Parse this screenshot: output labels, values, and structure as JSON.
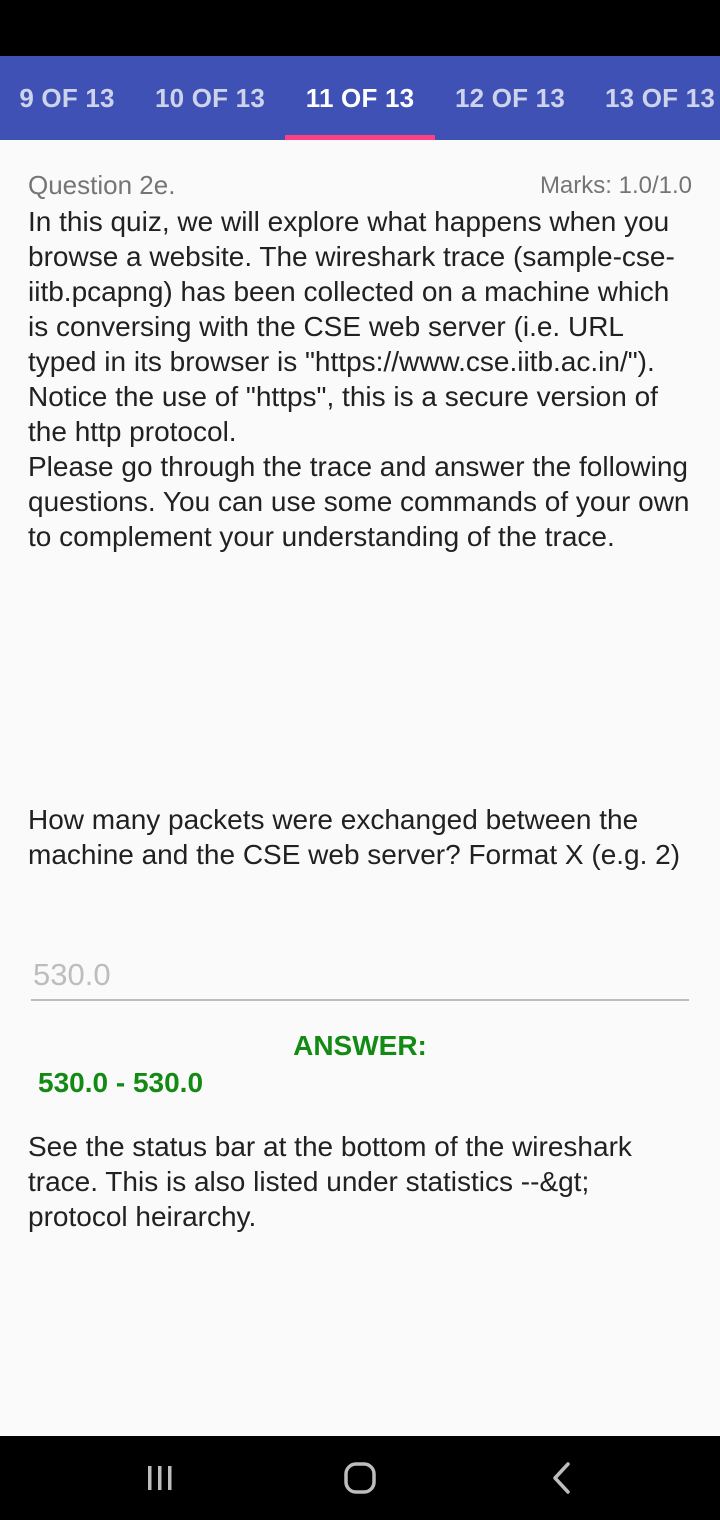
{
  "tabs": [
    {
      "label": "9 OF 13",
      "active": false
    },
    {
      "label": "10 OF 13",
      "active": false
    },
    {
      "label": "11 OF 13",
      "active": true
    },
    {
      "label": "12 OF 13",
      "active": false
    },
    {
      "label": "13 OF 13",
      "active": false
    }
  ],
  "question": {
    "number": "Question 2e.",
    "marks": "Marks: 1.0/1.0",
    "paragraphs": [
      "In this quiz, we will explore what happens when you browse a website. The wireshark trace (sample-cse-iitb.pcapng) has been collected on a machine which is conversing with the CSE web server (i.e. URL typed in its browser is \"https://www.cse.iitb.ac.in/\").",
      "Notice the use of \"https\", this is a secure version of the http protocol.",
      "Please go through the trace and answer the following questions. You can use some commands of your own to complement your understanding of the trace."
    ],
    "sub_question": "How many packets were exchanged between the machine and the CSE web server? Format X (e.g. 2)"
  },
  "answer": {
    "input_placeholder": "530.0",
    "label": "ANSWER:",
    "range": "530.0 - 530.0",
    "explanation": "See the status bar at the bottom of the wireshark trace. This is also listed under statistics --&gt; protocol heirarchy."
  },
  "colors": {
    "tab_bar": "#3f51b5",
    "tab_indicator": "#ff4081",
    "answer_green": "#138a13"
  },
  "nav": {
    "icons": [
      "recent-apps-icon",
      "home-icon",
      "back-icon"
    ]
  }
}
